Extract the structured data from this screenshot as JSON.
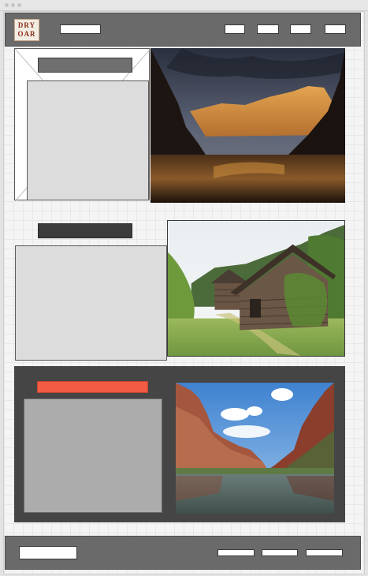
{
  "logo": {
    "line1": "DRY",
    "line2": "OAR"
  },
  "icons": {
    "photo_canyon_sunset": "photo-canyon-sunset",
    "photo_log_cabin": "photo-log-cabin",
    "photo_canyon_river": "photo-canyon-river"
  },
  "colors": {
    "header_bar": "#6a6a6a",
    "dark_panel": "#454545",
    "accent_title": "#f25c43"
  }
}
